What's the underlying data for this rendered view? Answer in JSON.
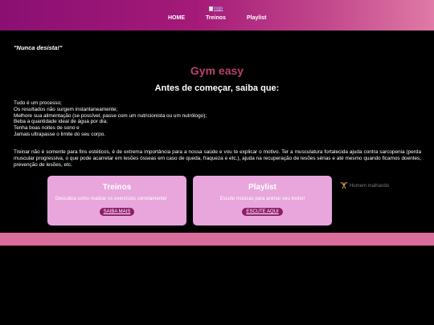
{
  "header": {
    "logo_alt": "logo",
    "nav": [
      {
        "label": "HOME"
      },
      {
        "label": "Treinos"
      },
      {
        "label": "Playlist"
      }
    ]
  },
  "motto": "\"Nunca desista!\"",
  "main": {
    "title": "Gym easy",
    "subtitle": "Antes de começar, saiba que:",
    "tips": [
      "Tudo é um processo;",
      "Os resultados não surgem instantaneamente;",
      "Melhore sua alimentação (se possível, passe com um nutricionista ou um nutrólogo);",
      "Beba a quantidade ideal de água por dia;",
      "Tenha boas noites de sono e",
      "Jamais ultrapasse o limite do seu corpo."
    ],
    "paragraph": "Treinar não é somente para fins estéticos, é de extrema importância para a nossa saúde e vou te explicar o motivo. Ter a musculatura fortalecida ajuda contra sarcopenia (perda muscular progressiva, o que pode acarretar em lesões ósseas em caso de queda, fraqueza e etc.), ajuda na recuperação de lesões sérias e até mesmo quando ficamos doentes, prevenção de lesões, etc."
  },
  "cards": {
    "treinos": {
      "title": "Treinos",
      "text": "Descubra como realizar os exercícios corretamente!",
      "button": "SAIBA MAIS"
    },
    "playlist": {
      "title": "Playlist",
      "text": "Escute músicas para animar seu treino!",
      "button": "ESCUTE AQUI"
    }
  },
  "gif_alt": "Homem malhando",
  "colors": {
    "header_start": "#8a0f72",
    "header_end": "#e07aa6",
    "title": "#b8406e",
    "card_bg": "#e8a6dc",
    "button_bg": "#8f1a6a",
    "footer": "#d96e9a"
  }
}
